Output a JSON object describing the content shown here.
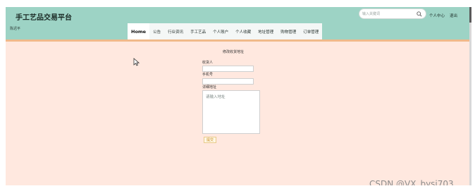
{
  "header": {
    "site_title": "手工艺品交易平台",
    "welcome_user": "陈迟平",
    "search_placeholder": "输入关键词",
    "user_center": "个人中心",
    "logout": "退出"
  },
  "nav": {
    "items": [
      {
        "label": "Home",
        "active": true
      },
      {
        "label": "公告"
      },
      {
        "label": "行业资讯"
      },
      {
        "label": "手工艺品"
      },
      {
        "label": "个人账户"
      },
      {
        "label": "个人收藏"
      },
      {
        "label": "地址管理"
      },
      {
        "label": "购物管理"
      },
      {
        "label": "订单管理"
      }
    ]
  },
  "form": {
    "title": "修改收货地址",
    "receiver_label": "收货人",
    "receiver_value": "",
    "phone_label": "手机号",
    "phone_value": "",
    "address_label": "详细地址",
    "address_placeholder": "请输入地址",
    "submit_label": "提交"
  },
  "watermark": "CSDN @VX_bysj703",
  "colors": {
    "header_bg": "#9dd3c5",
    "page_bg": "#ffe8df",
    "accent": "#f0b98a"
  },
  "icons": {
    "search": "search-icon",
    "cursor": "mouse-pointer-icon"
  }
}
